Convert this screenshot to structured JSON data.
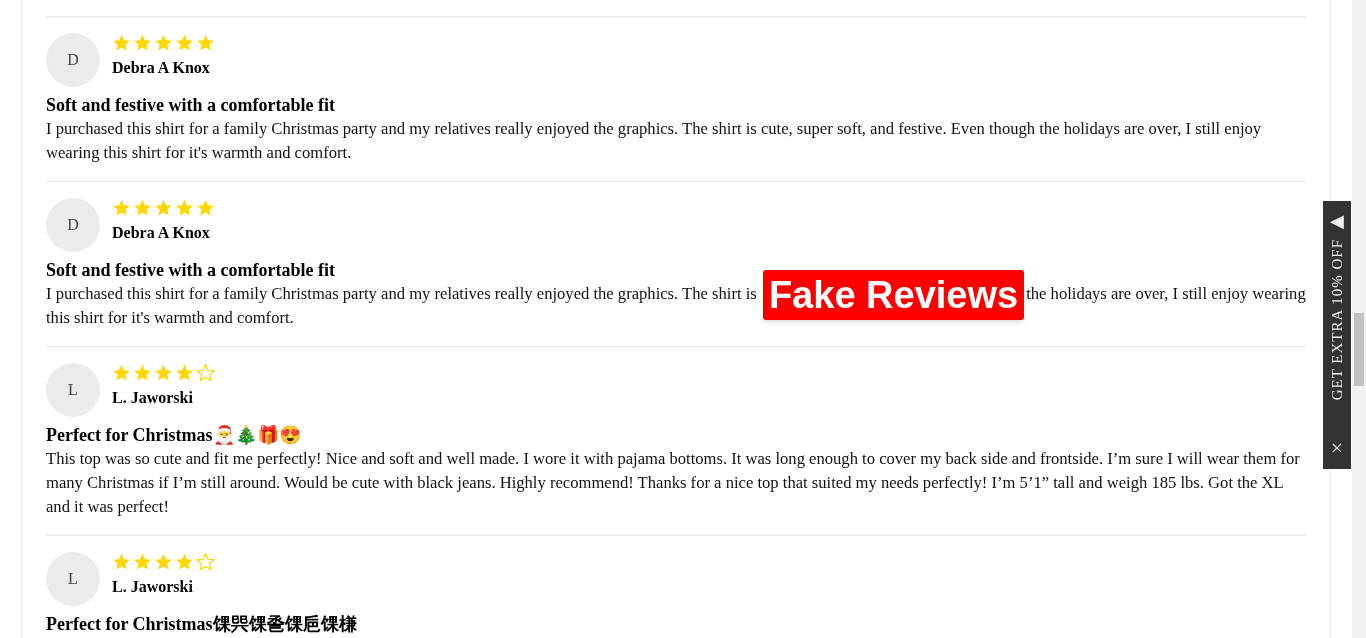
{
  "reviews": [
    {
      "avatar": "D",
      "stars": 5,
      "name": "Debra A Knox",
      "title": "Soft and festive with a comfortable fit",
      "body": [
        {
          "kind": "text",
          "text": "I purchased this shirt for a family Christmas party and my relatives really enjoyed the graphics. The shirt is cute, super soft, and festive. Even though the holidays are over, I still enjoy wearing this shirt for it's warmth and comfort."
        }
      ]
    },
    {
      "avatar": "D",
      "stars": 5,
      "name": "Debra A Knox",
      "title": "Soft and festive with a comfortable fit",
      "body": [
        {
          "kind": "text",
          "text": "I purchased this shirt for a family Christmas party and my relatives really enjoyed the graphics. The shirt is"
        },
        {
          "kind": "label",
          "text": "Fake Reviews"
        },
        {
          "kind": "text",
          "text": "the holidays are over, I still enjoy wearing this shirt for it's warmth and comfort."
        }
      ]
    },
    {
      "avatar": "L",
      "stars": 4,
      "name": "L. Jaworski",
      "title": "Perfect for Christmas🎅🎄🎁😍",
      "body": [
        {
          "kind": "text",
          "text": "This top was so cute and fit me perfectly! Nice and soft and well made. I wore it with pajama bottoms. It was long enough to cover my back side and frontside. I’m sure I will wear them for many Christmas if I’m still around. Would be cute with black jeans. Highly recommend! Thanks for a nice top that suited my needs perfectly! I’m 5’1” tall and weigh 185 lbs. Got the XL and it was perfect!"
        }
      ]
    },
    {
      "avatar": "L",
      "stars": 4,
      "name": "L. Jaworski",
      "title": "Perfect for Christmas馃巺馃巹馃巵馃槏"
    }
  ],
  "side_tab": {
    "arrow": "◀",
    "text": "GET EXTRA 10% OFF",
    "close": "×"
  }
}
